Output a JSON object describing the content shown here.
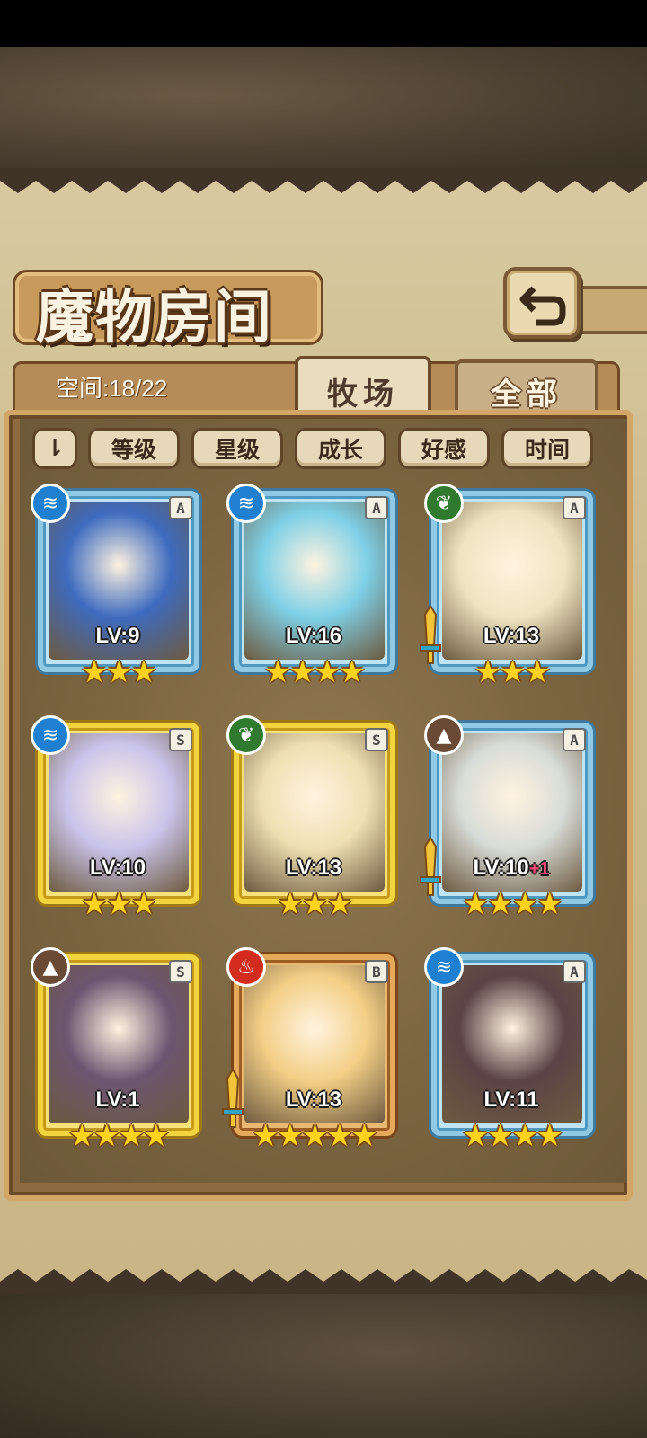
{
  "screen": {
    "title": "魔物房间",
    "space_label": "空间:18/22"
  },
  "tabs": [
    {
      "label": "牧场",
      "active": true
    },
    {
      "label": "全部",
      "active": false
    }
  ],
  "sort": {
    "toggle_label": "⇂",
    "buttons": [
      "等级",
      "星级",
      "成长",
      "好感",
      "时间"
    ]
  },
  "colors": {
    "water": "#1f7fd1",
    "nature": "#2f7a2e",
    "earth": "#6b4a35",
    "fire": "#d42b1f"
  },
  "monsters": [
    {
      "element": "water-icon",
      "rank": "A",
      "frame": "blue",
      "level": "LV:9",
      "bonus": "",
      "stars": 3,
      "weapon": false
    },
    {
      "element": "water-icon",
      "rank": "A",
      "frame": "blue",
      "level": "LV:16",
      "bonus": "",
      "stars": 4,
      "weapon": false
    },
    {
      "element": "leaf-icon",
      "rank": "A",
      "frame": "blue",
      "level": "LV:13",
      "bonus": "",
      "stars": 3,
      "weapon": true
    },
    {
      "element": "water-icon",
      "rank": "S",
      "frame": "gold",
      "level": "LV:10",
      "bonus": "",
      "stars": 3,
      "weapon": false
    },
    {
      "element": "leaf-icon",
      "rank": "S",
      "frame": "gold",
      "level": "LV:13",
      "bonus": "",
      "stars": 3,
      "weapon": false
    },
    {
      "element": "mountain-icon",
      "rank": "A",
      "frame": "blue",
      "level": "LV:10",
      "bonus": "+1",
      "stars": 4,
      "weapon": true
    },
    {
      "element": "mountain-icon",
      "rank": "S",
      "frame": "gold",
      "level": "LV:1",
      "bonus": "",
      "stars": 4,
      "weapon": false
    },
    {
      "element": "flame-icon",
      "rank": "B",
      "frame": "bronze",
      "level": "LV:13",
      "bonus": "",
      "stars": 5,
      "weapon": true
    },
    {
      "element": "water-icon",
      "rank": "A",
      "frame": "blue",
      "level": "LV:11",
      "bonus": "",
      "stars": 4,
      "weapon": false
    }
  ]
}
